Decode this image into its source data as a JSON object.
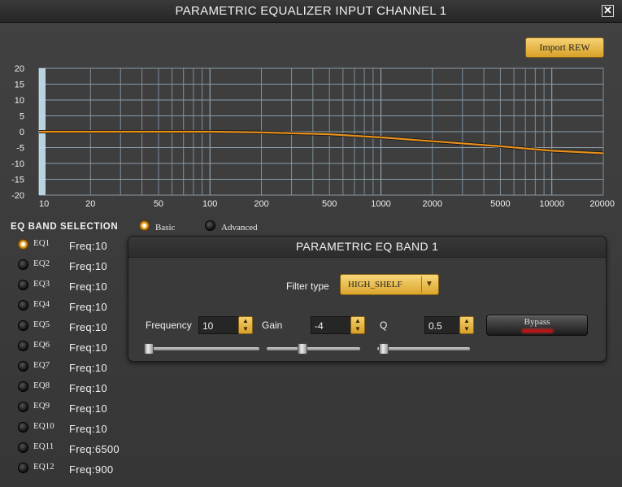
{
  "window": {
    "title": "PARAMETRIC EQUALIZER INPUT CHANNEL 1",
    "close_label": "✕"
  },
  "toolbar": {
    "import_label": "Import REW"
  },
  "graph": {
    "y_ticks": [
      "20",
      "15",
      "10",
      "5",
      "0",
      "-5",
      "-10",
      "-15",
      "-20"
    ],
    "x_ticks": [
      "10",
      "20",
      "50",
      "100",
      "200",
      "500",
      "1000",
      "2000",
      "5000",
      "10000",
      "20000"
    ],
    "y_range": [
      -20,
      20
    ],
    "x_range": [
      10,
      20000
    ],
    "x_scale": "log",
    "curve_color": "#e8901c",
    "curve": [
      [
        10,
        0
      ],
      [
        20,
        0
      ],
      [
        50,
        0
      ],
      [
        100,
        0
      ],
      [
        200,
        -0.2
      ],
      [
        500,
        -0.8
      ],
      [
        1000,
        -1.8
      ],
      [
        2000,
        -3.0
      ],
      [
        5000,
        -4.6
      ],
      [
        10000,
        -6.0
      ],
      [
        20000,
        -6.8
      ]
    ]
  },
  "band_selection": {
    "title": "EQ BAND SELECTION",
    "selected_index": 0,
    "bands": [
      {
        "name": "EQ1",
        "freq": "Freq:10"
      },
      {
        "name": "EQ2",
        "freq": "Freq:10"
      },
      {
        "name": "EQ3",
        "freq": "Freq:10"
      },
      {
        "name": "EQ4",
        "freq": "Freq:10"
      },
      {
        "name": "EQ5",
        "freq": "Freq:10"
      },
      {
        "name": "EQ6",
        "freq": "Freq:10"
      },
      {
        "name": "EQ7",
        "freq": "Freq:10"
      },
      {
        "name": "EQ8",
        "freq": "Freq:10"
      },
      {
        "name": "EQ9",
        "freq": "Freq:10"
      },
      {
        "name": "EQ10",
        "freq": "Freq:10"
      },
      {
        "name": "EQ11",
        "freq": "Freq:6500"
      },
      {
        "name": "EQ12",
        "freq": "Freq:900"
      }
    ]
  },
  "mode": {
    "basic_label": "Basic",
    "advanced_label": "Advanced",
    "selected": "Basic"
  },
  "band_panel": {
    "title": "PARAMETRIC EQ BAND 1",
    "filter_type_label": "Filter type",
    "filter_type_value": "HIGH_SHELF",
    "frequency_label": "Frequency",
    "frequency_value": "10",
    "frequency_level": 0.0,
    "gain_label": "Gain",
    "gain_value": "-4",
    "gain_level": 0.37,
    "q_label": "Q",
    "q_value": "0.5",
    "q_level": 0.02,
    "bypass_label": "Bypass"
  }
}
